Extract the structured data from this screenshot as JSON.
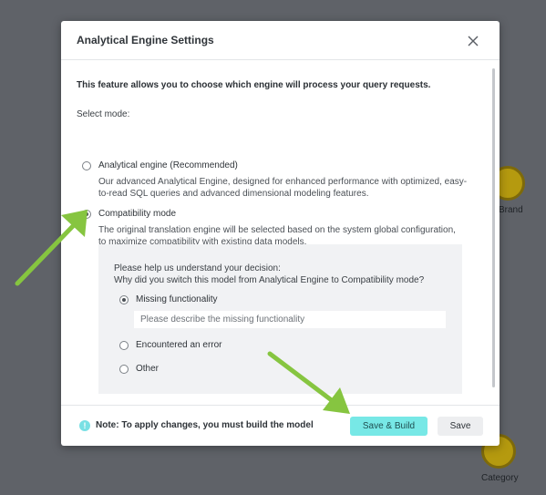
{
  "background": {
    "nodes": [
      {
        "label": "Brand"
      },
      {
        "label": "Category"
      }
    ]
  },
  "dialog": {
    "title": "Analytical Engine Settings",
    "intro": "This feature allows you to choose which engine will process your query requests.",
    "select_mode_label": "Select mode:",
    "options": [
      {
        "label": "Analytical engine (Recommended)",
        "description_line1": "Our advanced Analytical Engine, designed for enhanced performance with optimized, easy-",
        "description_line2": "to-read SQL queries and advanced dimensional modeling features.",
        "selected": false
      },
      {
        "label": "Compatibility mode",
        "description_line1": "The original translation engine will be selected based on the system global configuration,",
        "description_line2": "to maximize compatibility with existing data models.",
        "selected": true
      }
    ],
    "feedback": {
      "question_line1": "Please help us understand your decision:",
      "question_line2": "Why did you switch this model from Analytical Engine to Compatibility mode?",
      "reasons": [
        {
          "label": "Missing functionality",
          "selected": true
        },
        {
          "label": "Encountered an error",
          "selected": false
        },
        {
          "label": "Other",
          "selected": false
        }
      ],
      "input_placeholder": "Please describe the missing functionality"
    },
    "footer": {
      "note": "Note: To apply changes, you must build the model",
      "save_build_label": "Save & Build",
      "save_label": "Save"
    }
  },
  "colors": {
    "backdrop": "#5f6268",
    "accent_button": "#77e8e6",
    "info_icon": "#79e0e4",
    "annotation_arrow": "#86c540",
    "node_fill": "#b59a0f"
  },
  "icons": [
    "close-icon",
    "info-icon",
    "annotation-arrow"
  ]
}
